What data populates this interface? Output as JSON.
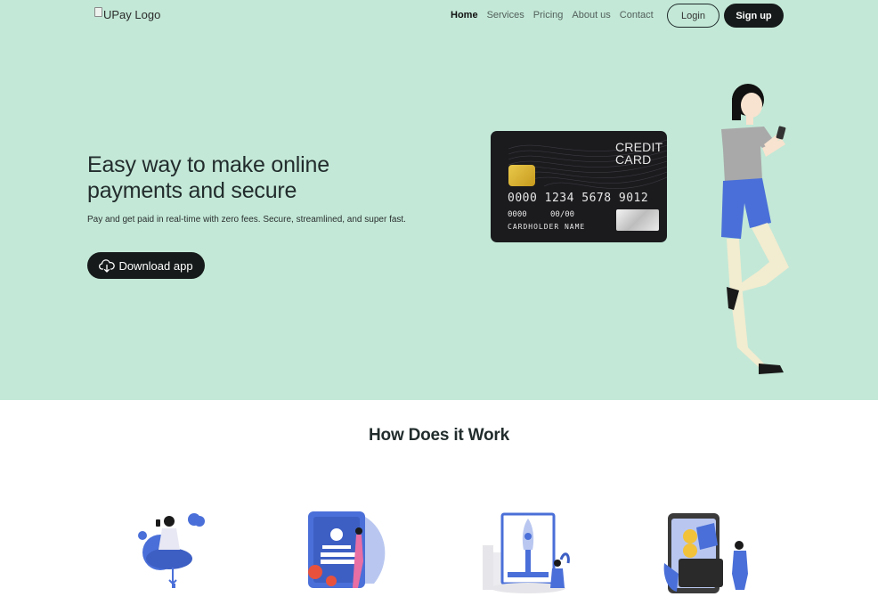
{
  "nav": {
    "logo_text": "UPay Logo",
    "links": [
      "Home",
      "Services",
      "Pricing",
      "About us",
      "Contact"
    ],
    "login_label": "Login",
    "signup_label": "Sign up"
  },
  "hero": {
    "headline": "Easy way to make online payments and secure",
    "subtitle": "Pay and get paid in real-time with zero fees. Secure, streamlined, and super fast.",
    "download_label": "Download app",
    "card": {
      "title": "CREDIT CARD",
      "number": "0000 1234 5678 9012",
      "small_left": "0000",
      "small_right": "00/00",
      "holder": "CARDHOLDER NAME"
    }
  },
  "how": {
    "title": "How Does it Work"
  },
  "colors": {
    "hero_bg": "#c3e8d7",
    "dark": "#161a1a",
    "accent_blue": "#4a6fd8"
  },
  "icons": [
    "cloud-download-icon",
    "broken-image-icon"
  ]
}
